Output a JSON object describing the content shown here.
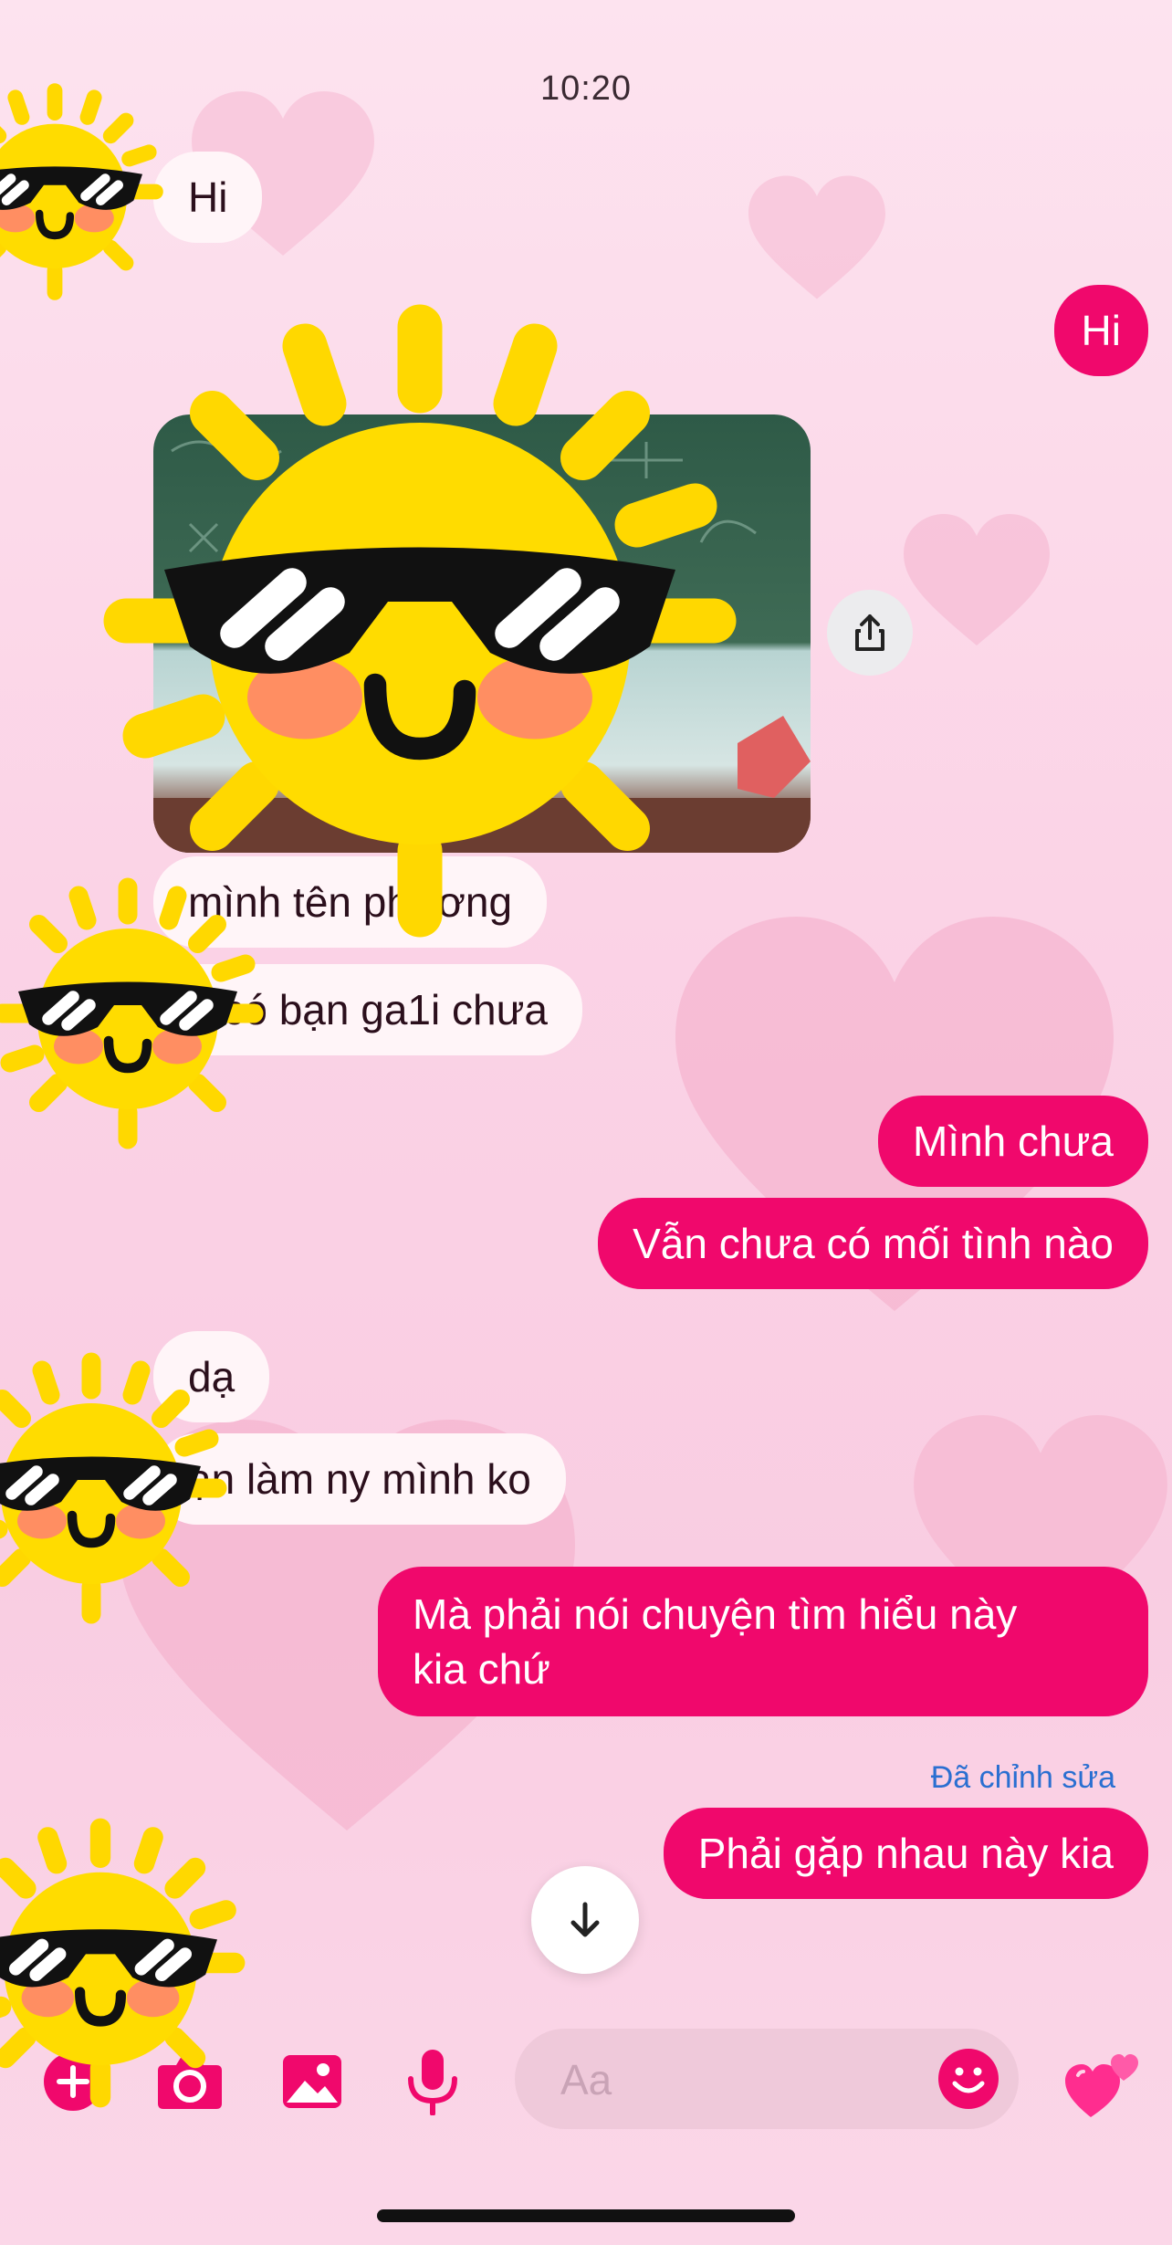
{
  "status": {
    "time": "10:20"
  },
  "messages": {
    "in_hi": "Hi",
    "out_hi": "Hi",
    "in_name": "mình tên phương",
    "in_girlfriend": "n có bạn ga1i chưa",
    "out_not_yet": "Mình chưa",
    "out_never": "Vẫn chưa có mối tình nào",
    "in_da": "dạ",
    "in_ask": "ạn làm ny mình ko",
    "out_talk_line1": "Mà phải nói chuyện tìm hiểu này",
    "out_talk_line2": "kia chứ",
    "edited_label": "Đã chỉnh sửa",
    "out_meet": "Phải gặp nhau này kia"
  },
  "composer": {
    "placeholder": "Aa"
  },
  "icons": {
    "share": "share-icon",
    "scroll_down": "arrow-down-icon",
    "add": "plus-icon",
    "camera": "camera-icon",
    "gallery": "image-icon",
    "mic": "microphone-icon",
    "emoji": "emoji-icon",
    "like": "hearts-icon",
    "sticker": "sunglasses-sun-sticker"
  },
  "colors": {
    "accent": "#f0086c",
    "incoming_bubble": "#fff5f8",
    "edited_text": "#2a6fd1"
  }
}
